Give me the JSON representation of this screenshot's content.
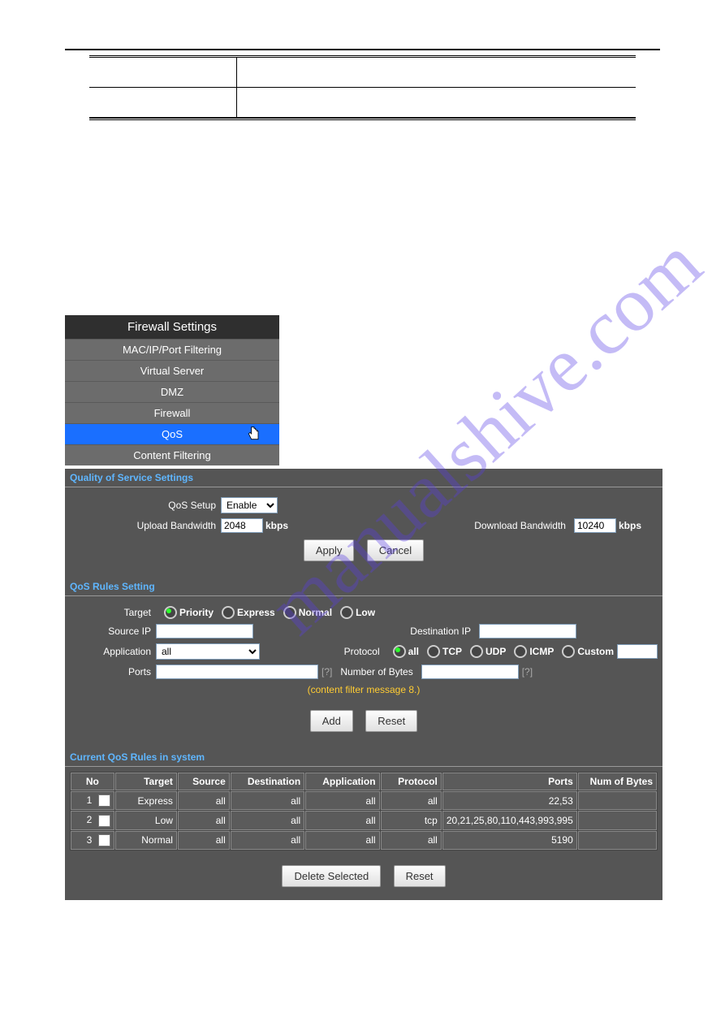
{
  "watermark": "manualshive.com",
  "sidebar": {
    "header": "Firewall Settings",
    "items": [
      "MAC/IP/Port Filtering",
      "Virtual Server",
      "DMZ",
      "Firewall",
      "QoS",
      "Content Filtering"
    ],
    "active_index": 4
  },
  "qos_settings": {
    "title": "Quality of Service Settings",
    "setup_label": "QoS Setup",
    "setup_value": "Enable",
    "upload_label": "Upload Bandwidth",
    "upload_value": "2048",
    "download_label": "Download Bandwidth",
    "download_value": "10240",
    "unit": "kbps",
    "apply": "Apply",
    "cancel": "Cancel"
  },
  "rules_setting": {
    "title": "QoS Rules Setting",
    "target_label": "Target",
    "targets": [
      "Priority",
      "Express",
      "Normal",
      "Low"
    ],
    "target_selected": 0,
    "source_ip_label": "Source IP",
    "source_ip_value": "",
    "dest_ip_label": "Destination IP",
    "dest_ip_value": "",
    "application_label": "Application",
    "application_value": "all",
    "protocol_label": "Protocol",
    "protocols": [
      "all",
      "TCP",
      "UDP",
      "ICMP",
      "Custom"
    ],
    "protocol_selected": 0,
    "custom_value": "",
    "ports_label": "Ports",
    "ports_value": "",
    "bytes_label": "Number of Bytes",
    "bytes_value": "",
    "filter_msg": "(content filter message 8.)",
    "add": "Add",
    "reset": "Reset"
  },
  "current_rules": {
    "title": "Current QoS Rules in system",
    "headers": [
      "No",
      "Target",
      "Source",
      "Destination",
      "Application",
      "Protocol",
      "Ports",
      "Num of Bytes"
    ],
    "rows": [
      {
        "no": "1",
        "target": "Express",
        "source": "all",
        "destination": "all",
        "application": "all",
        "protocol": "all",
        "ports": "22,53",
        "bytes": ""
      },
      {
        "no": "2",
        "target": "Low",
        "source": "all",
        "destination": "all",
        "application": "all",
        "protocol": "tcp",
        "ports": "20,21,25,80,110,443,993,995",
        "bytes": ""
      },
      {
        "no": "3",
        "target": "Normal",
        "source": "all",
        "destination": "all",
        "application": "all",
        "protocol": "all",
        "ports": "5190",
        "bytes": ""
      }
    ],
    "delete_selected": "Delete Selected",
    "reset": "Reset"
  }
}
